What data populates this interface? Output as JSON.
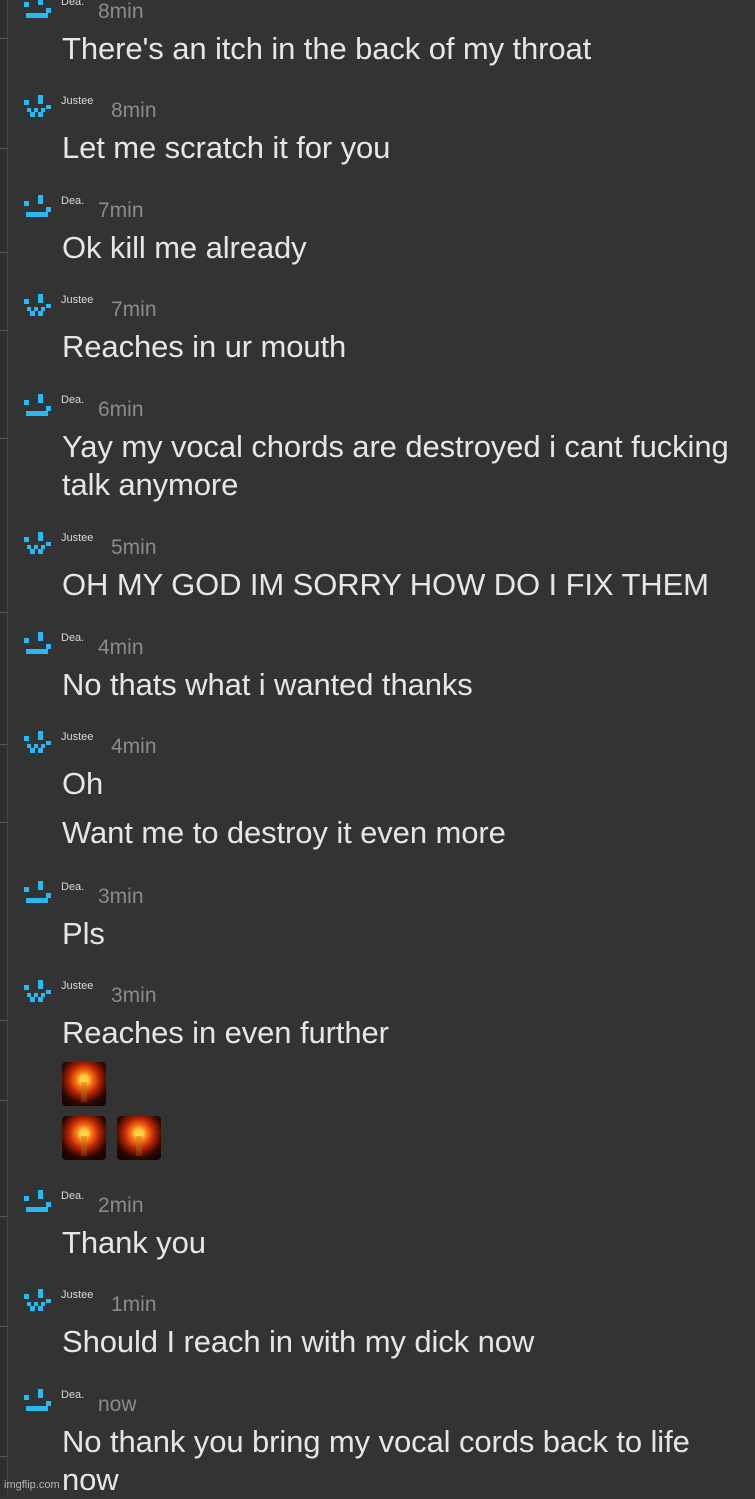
{
  "colors": {
    "background": "#333333",
    "avatar_cyan": "#29b8f0",
    "text": "#e6e6e6",
    "time": "#8b8b8b"
  },
  "messages": [
    {
      "author": "Dea.",
      "avatar": "smile-face-icon",
      "time": "8min",
      "lines": [
        "There's an itch in the back of my throat"
      ]
    },
    {
      "author": "Justee",
      "avatar": "w-face-icon",
      "time": "8min",
      "lines": [
        "Let me scratch it for you"
      ]
    },
    {
      "author": "Dea.",
      "avatar": "smile-face-icon",
      "time": "7min",
      "lines": [
        "Ok kill me already"
      ]
    },
    {
      "author": "Justee",
      "avatar": "w-face-icon",
      "time": "7min",
      "lines": [
        "Reaches in ur mouth"
      ]
    },
    {
      "author": "Dea.",
      "avatar": "smile-face-icon",
      "time": "6min",
      "lines": [
        "Yay my vocal chords are destroyed i cant fucking talk anymore"
      ]
    },
    {
      "author": "Justee",
      "avatar": "w-face-icon",
      "time": "5min",
      "lines": [
        "OH MY GOD IM SORRY HOW DO I FIX THEM"
      ]
    },
    {
      "author": "Dea.",
      "avatar": "smile-face-icon",
      "time": "4min",
      "lines": [
        "No thats what i wanted thanks"
      ]
    },
    {
      "author": "Justee",
      "avatar": "w-face-icon",
      "time": "4min",
      "lines": [
        "Oh",
        "Want me to destroy it even more"
      ]
    },
    {
      "author": "Dea.",
      "avatar": "smile-face-icon",
      "time": "3min",
      "lines": [
        "Pls"
      ]
    },
    {
      "author": "Justee",
      "avatar": "w-face-icon",
      "time": "3min",
      "lines": [
        "Reaches in even further"
      ],
      "emoji_rows": [
        [
          "explosion-emoji"
        ],
        [
          "explosion-emoji",
          "explosion-emoji"
        ]
      ]
    },
    {
      "author": "Dea.",
      "avatar": "smile-face-icon",
      "time": "2min",
      "lines": [
        "Thank you"
      ]
    },
    {
      "author": "Justee",
      "avatar": "w-face-icon",
      "time": "1min",
      "lines": [
        "Should I reach in with my dick now"
      ]
    },
    {
      "author": "Dea.",
      "avatar": "smile-face-icon",
      "time": "now",
      "lines": [
        "No thank you bring my vocal cords back to life now"
      ]
    }
  ],
  "watermark": "imgflip.com"
}
